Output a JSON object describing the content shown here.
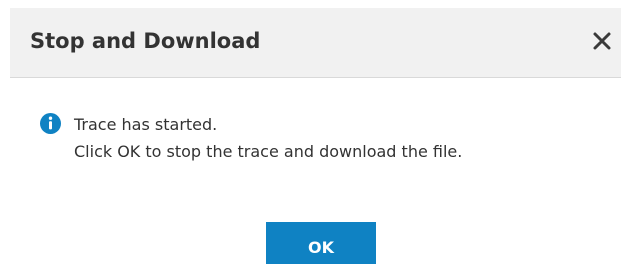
{
  "dialog": {
    "title": "Stop and Download",
    "close_icon": "close-icon",
    "info_icon": "info-icon",
    "message_lines": [
      "Trace has started.",
      "Click OK to stop the trace and download the file."
    ],
    "ok_label": "OK"
  },
  "colors": {
    "header_background": "#f1f1f1",
    "primary_button": "#0f82c3",
    "info_icon": "#0f82c3",
    "text": "#333333"
  }
}
